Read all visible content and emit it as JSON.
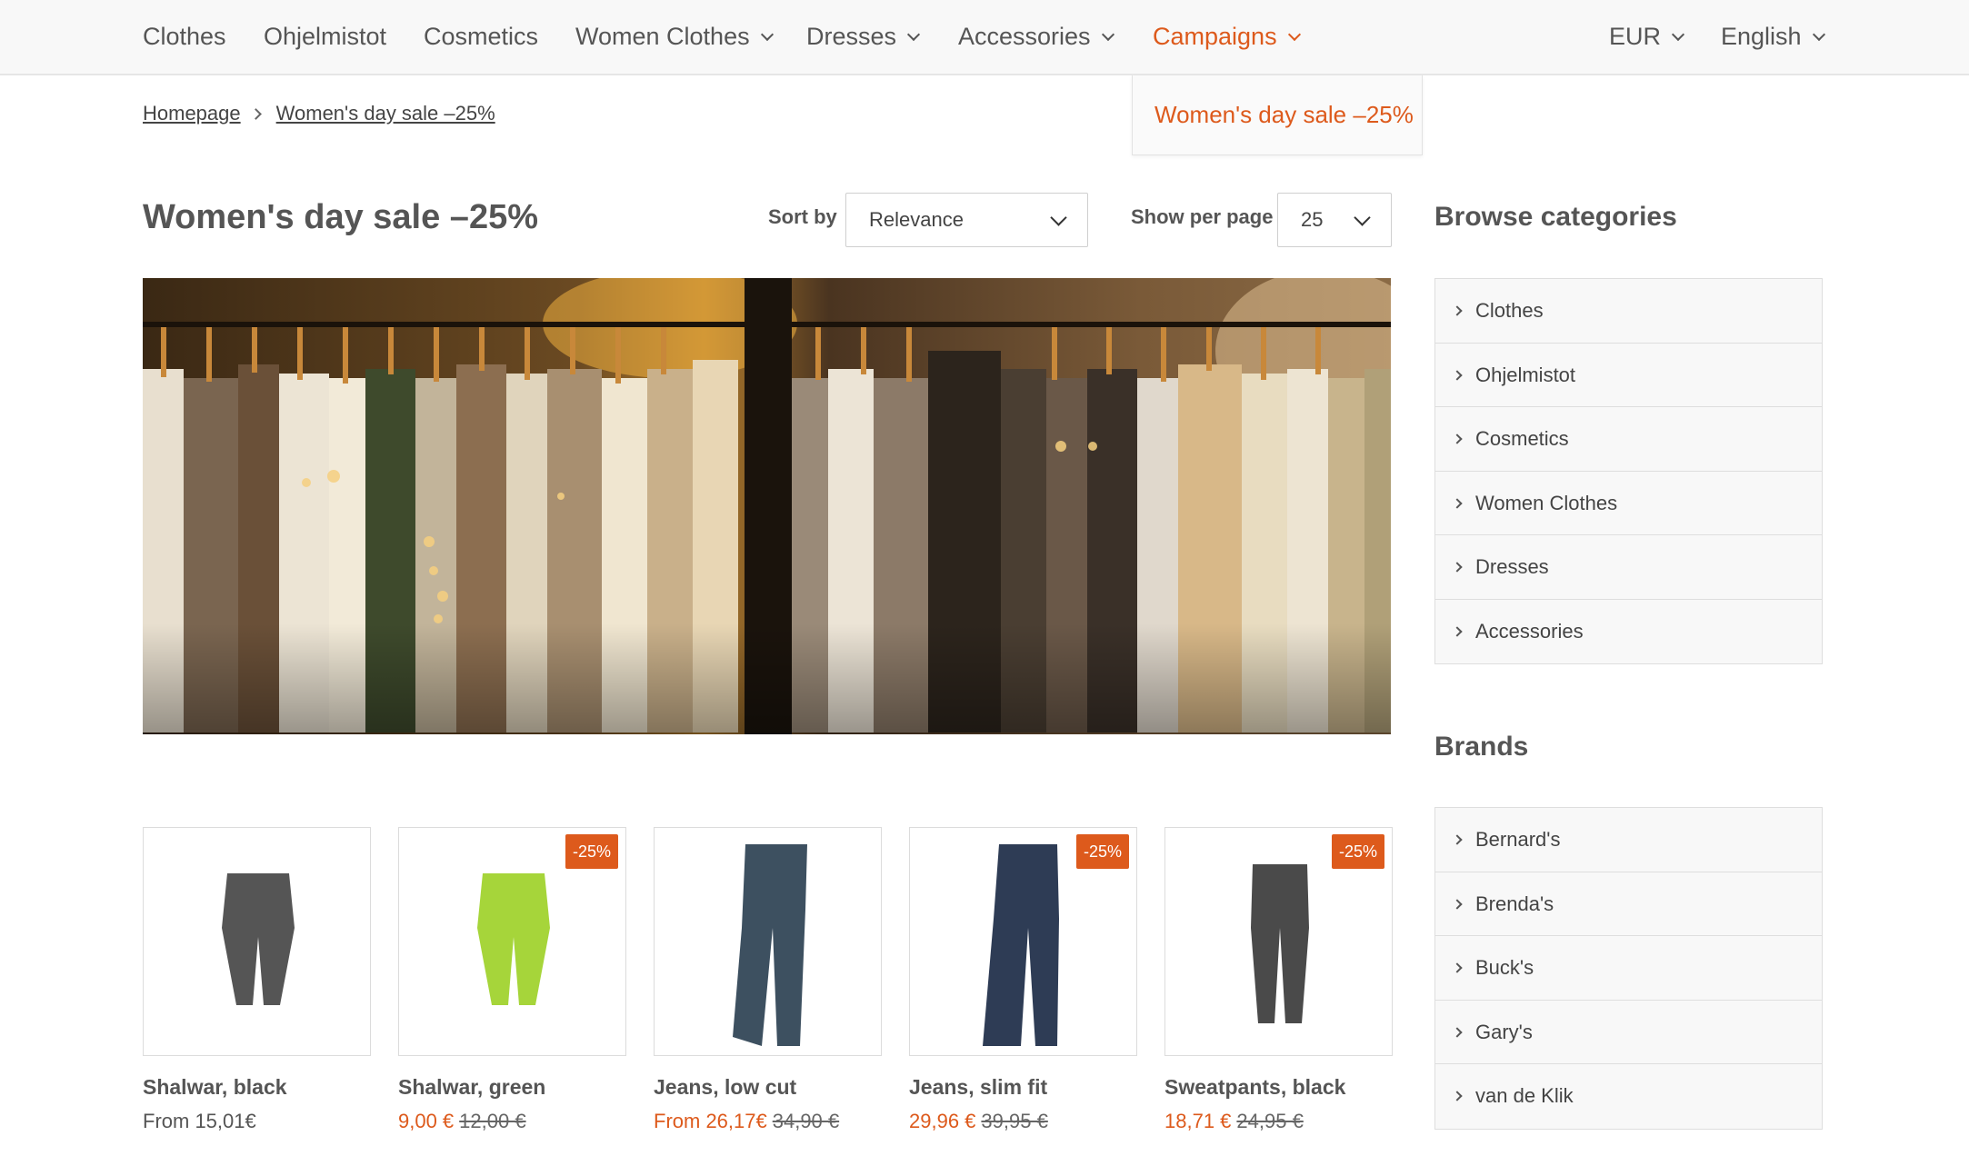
{
  "nav": {
    "items": [
      {
        "label": "Clothes"
      },
      {
        "label": "Ohjelmistot"
      },
      {
        "label": "Cosmetics"
      },
      {
        "label": "Women Clothes"
      },
      {
        "label": "Dresses"
      },
      {
        "label": "Accessories"
      },
      {
        "label": "Campaigns"
      }
    ],
    "currency": "EUR",
    "language": "English",
    "active_color": "#dd5a1c"
  },
  "dropdown": {
    "item": "Women's day sale –25%"
  },
  "breadcrumb": {
    "home": "Homepage",
    "current": "Women's day sale –25%"
  },
  "page": {
    "title": "Women's day sale –25%",
    "sort_label": "Sort by",
    "sort_value": "Relevance",
    "perpage_label": "Show per page",
    "perpage_value": "25"
  },
  "products": [
    {
      "name": "Shalwar, black",
      "prefix": "From 15,01€",
      "badge": ""
    },
    {
      "name": "Shalwar, green",
      "sale": "9,00 €",
      "old": "12,00 €",
      "badge": "-25%"
    },
    {
      "name": "Jeans, low cut",
      "sale": "From 26,17€",
      "old": "34,90 €",
      "badge": ""
    },
    {
      "name": "Jeans, slim fit",
      "sale": "29,96 €",
      "old": "39,95 €",
      "badge": "-25%"
    },
    {
      "name": "Sweatpants, black",
      "sale": "18,71 €",
      "old": "24,95 €",
      "badge": "-25%"
    }
  ],
  "sidebar": {
    "categories_heading": "Browse categories",
    "categories": [
      "Clothes",
      "Ohjelmistot",
      "Cosmetics",
      "Women Clothes",
      "Dresses",
      "Accessories"
    ],
    "brands_heading": "Brands",
    "brands": [
      "Bernard's",
      "Brenda's",
      "Buck's",
      "Gary's",
      "van de Klik"
    ]
  }
}
